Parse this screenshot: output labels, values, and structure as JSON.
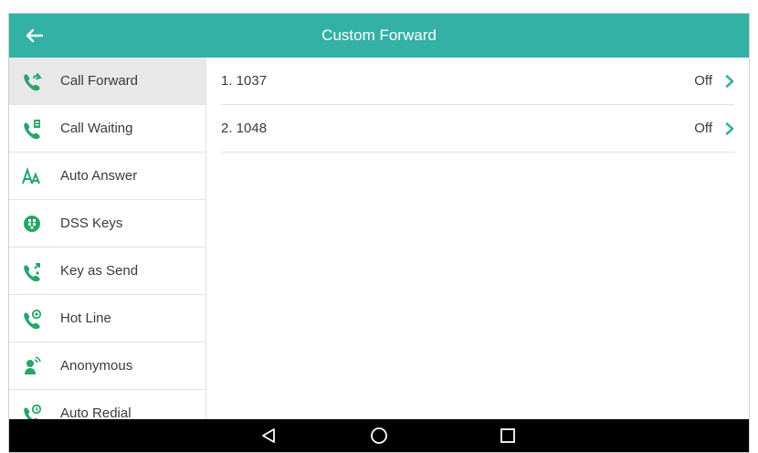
{
  "header": {
    "title": "Custom Forward",
    "icon": "arrow-left-icon"
  },
  "sidebar": {
    "items": [
      {
        "label": "Call Forward",
        "icon": "call-forward-icon"
      },
      {
        "label": "Call Waiting",
        "icon": "call-waiting-icon"
      },
      {
        "label": "Auto Answer",
        "icon": "auto-answer-icon"
      },
      {
        "label": "DSS Keys",
        "icon": "dss-keys-icon"
      },
      {
        "label": "Key as Send",
        "icon": "key-as-send-icon"
      },
      {
        "label": "Hot Line",
        "icon": "hot-line-icon"
      },
      {
        "label": "Anonymous",
        "icon": "anonymous-icon"
      },
      {
        "label": "Auto Redial",
        "icon": "auto-redial-icon"
      }
    ]
  },
  "main": {
    "rows": [
      {
        "name": "1. 1037",
        "value": "Off"
      },
      {
        "name": "2. 1048",
        "value": "Off"
      }
    ]
  },
  "navbar": {
    "back": "back-triangle-icon",
    "home": "home-circle-icon",
    "recent": "recent-square-icon"
  },
  "colors": {
    "accent": "#33b1a5",
    "icon_green": "#27a56a",
    "navbar": "#000000"
  }
}
